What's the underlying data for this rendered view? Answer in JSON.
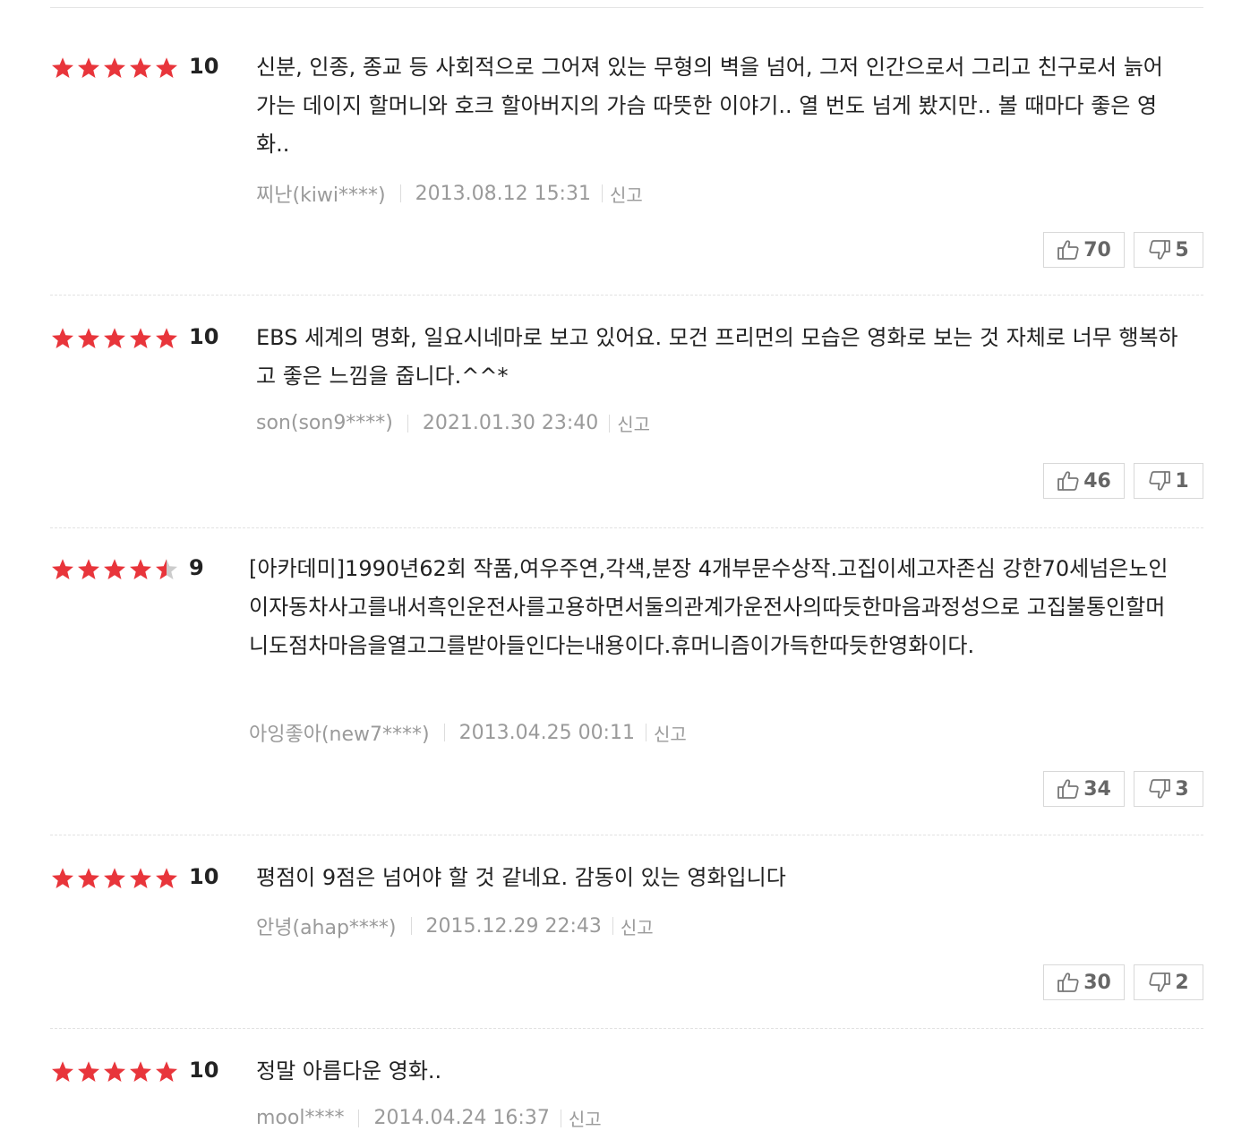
{
  "colors": {
    "star_on": "#e8353b",
    "star_off": "#cccccc",
    "meta": "#9a9a9a"
  },
  "icons": {
    "star": "star-icon",
    "like": "thumbs-up-icon",
    "dislike": "thumbs-down-icon"
  },
  "reviews": [
    {
      "rating": 5,
      "score": "10",
      "text": "신분, 인종, 종교 등 사회적으로 그어져 있는 무형의 벽을 넘어, 그저 인간으로서 그리고 친구로서 늙어가는 데이지 할머니와 호크 할아버지의 가슴 따뜻한 이야기.. 열 번도 넘게 봤지만.. 볼 때마다 좋은 영화..",
      "author": "찌난(kiwi****)",
      "date": "2013.08.12 15:31",
      "report": "신고",
      "likes": "70",
      "dislikes": "5"
    },
    {
      "rating": 5,
      "score": "10",
      "text": "EBS 세계의 명화, 일요시네마로 보고 있어요. 모건 프리먼의 모습은 영화로 보는 것 자체로 너무 행복하고 좋은 느낌을 줍니다.^^*",
      "author": "son(son9****)",
      "date": "2021.01.30 23:40",
      "report": "신고",
      "likes": "46",
      "dislikes": "1"
    },
    {
      "rating": 4.5,
      "score": "9",
      "text": "[아카데미]1990년62회 작품,여우주연,각색,분장 4개부문수상작.고집이세고자존심 강한70세넘은노인이자동차사고를내서흑인운전사를고용하면서둘의관계가운전사의따듯한마음과정성으로 고집불통인할머니도점차마음을열고그를받아들인다는내용이다.휴머니즘이가득한따듯한영화이다.",
      "author": "아잉좋아(new7****)",
      "date": "2013.04.25 00:11",
      "report": "신고",
      "likes": "34",
      "dislikes": "3"
    },
    {
      "rating": 5,
      "score": "10",
      "text": "평점이 9점은 넘어야 할 것 같네요. 감동이 있는 영화입니다",
      "author": "안녕(ahap****)",
      "date": "2015.12.29 22:43",
      "report": "신고",
      "likes": "30",
      "dislikes": "2"
    },
    {
      "rating": 5,
      "score": "10",
      "text": "정말 아름다운 영화..",
      "author": "mool****",
      "date": "2014.04.24 16:37",
      "report": "신고",
      "likes": "",
      "dislikes": ""
    }
  ]
}
